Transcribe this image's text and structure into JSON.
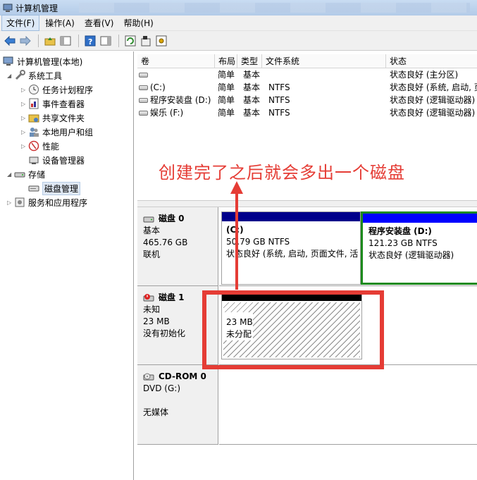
{
  "window": {
    "title": "计算机管理"
  },
  "menu": [
    "文件(F)",
    "操作(A)",
    "查看(V)",
    "帮助(H)"
  ],
  "tree": {
    "root": "计算机管理(本地)",
    "system_tools": "系统工具",
    "task_scheduler": "任务计划程序",
    "event_viewer": "事件查看器",
    "shared_folders": "共享文件夹",
    "local_users": "本地用户和组",
    "performance": "性能",
    "device_manager": "设备管理器",
    "storage": "存储",
    "disk_management": "磁盘管理",
    "services": "服务和应用程序"
  },
  "volume_list": {
    "columns": [
      "卷",
      "布局",
      "类型",
      "文件系统",
      "状态"
    ],
    "rows": [
      {
        "volume": "",
        "layout": "简单",
        "type": "基本",
        "fs": "",
        "status": "状态良好 (主分区)"
      },
      {
        "volume": "(C:)",
        "layout": "简单",
        "type": "基本",
        "fs": "NTFS",
        "status": "状态良好 (系统, 启动, 页"
      },
      {
        "volume": "程序安装盘 (D:)",
        "layout": "简单",
        "type": "基本",
        "fs": "NTFS",
        "status": "状态良好 (逻辑驱动器)"
      },
      {
        "volume": "娱乐 (F:)",
        "layout": "简单",
        "type": "基本",
        "fs": "NTFS",
        "status": "状态良好 (逻辑驱动器)"
      }
    ]
  },
  "annotation": "创建完了之后就会多出一个磁盘",
  "disks": {
    "disk0": {
      "name": "磁盘 0",
      "type": "基本",
      "size": "465.76 GB",
      "state": "联机",
      "partitions": [
        {
          "name": "(C:)",
          "size": "50.79 GB NTFS",
          "status": "状态良好 (系统, 启动, 页面文件, 活"
        },
        {
          "name": "程序安装盘  (D:)",
          "size": "121.23 GB NTFS",
          "status": "状态良好 (逻辑驱动器)"
        }
      ]
    },
    "disk1": {
      "name": "磁盘 1",
      "type": "未知",
      "size": "23 MB",
      "state": "没有初始化",
      "unallocated": {
        "size": "23 MB",
        "label": "未分配"
      }
    },
    "cdrom0": {
      "name": "CD-ROM 0",
      "type": "DVD (G:)",
      "state": "无媒体"
    }
  },
  "colors": {
    "primary_bar": "#00008b",
    "logical_bar": "#0000ff",
    "annotation": "#e53c35"
  }
}
